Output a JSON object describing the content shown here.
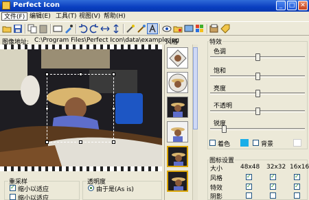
{
  "window": {
    "title": "Perfect Icon"
  },
  "menu": [
    "文件(F)",
    "编辑(E)",
    "工具(T)",
    "视图(V)",
    "帮助(H)"
  ],
  "address": {
    "label": "图像地址:",
    "value": "C:\\Program Files\\Perfect Icon\\data\\example.jpg"
  },
  "style_panel": {
    "label": "风格"
  },
  "effects": {
    "title": "特效",
    "sliders": [
      {
        "label": "色调",
        "value": 0.5
      },
      {
        "label": "饱和",
        "value": 0.5
      },
      {
        "label": "亮度",
        "value": 0.5
      },
      {
        "label": "不透明",
        "value": 0.5
      },
      {
        "label": "锐度",
        "value": 0.13
      }
    ],
    "tint_label": "着色",
    "tint_checked": false,
    "tint_color": "#1aaee8",
    "background_label": "背景",
    "background_checked": false,
    "background_color": "#ffffff"
  },
  "icon_settings": {
    "title": "图标设置",
    "size_label": "大小",
    "columns": [
      "48x48",
      "32x32",
      "16x16"
    ],
    "rows": [
      {
        "label": "风格",
        "checks": [
          true,
          true,
          true
        ]
      },
      {
        "label": "特效",
        "checks": [
          true,
          true,
          true
        ]
      },
      {
        "label": "阴影",
        "checks": [
          false,
          false,
          false
        ]
      }
    ]
  },
  "resample": {
    "title": "重采样",
    "options": [
      {
        "label": "缩小以适应",
        "checked": true
      },
      {
        "label": "缩小以适应",
        "checked": false
      }
    ]
  },
  "transparency": {
    "title": "透明度",
    "option": "由于是(As is)"
  }
}
